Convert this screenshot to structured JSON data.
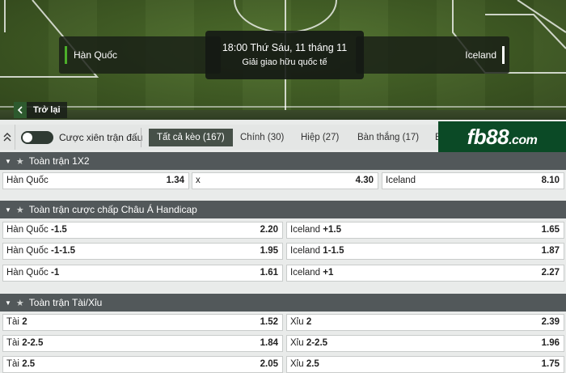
{
  "match": {
    "home_team": "Hàn Quốc",
    "away_team": "Iceland",
    "datetime": "18:00 Thứ Sáu, 11 tháng 11",
    "league": "Giải giao hữu quốc tế",
    "back_label": "Trở lại"
  },
  "toolbar": {
    "toggle_label": "Cược xiên trận đấu",
    "tabs": [
      {
        "label": "Tất cả kèo (167)",
        "active": true
      },
      {
        "label": "Chính (30)"
      },
      {
        "label": "Hiệp (27)"
      },
      {
        "label": "Bàn thắng (17)"
      },
      {
        "label": "B"
      }
    ]
  },
  "logo": {
    "text": "fb88",
    "suffix": ".com"
  },
  "sections": [
    {
      "title": "Toàn trận 1X2",
      "rows": [
        [
          {
            "label": "Hàn Quốc",
            "line": "",
            "odds": "1.34"
          },
          {
            "label": "x",
            "line": "",
            "odds": "4.30"
          },
          {
            "label": "Iceland",
            "line": "",
            "odds": "8.10"
          }
        ]
      ]
    },
    {
      "title": "Toàn trận cược chấp Châu Á Handicap",
      "rows": [
        [
          {
            "label": "Hàn Quốc",
            "line": "-1.5",
            "odds": "2.20"
          },
          {
            "label": "Iceland",
            "line": "+1.5",
            "odds": "1.65"
          }
        ],
        [
          {
            "label": "Hàn Quốc",
            "line": "-1-1.5",
            "odds": "1.95"
          },
          {
            "label": "Iceland",
            "line": "1-1.5",
            "odds": "1.87"
          }
        ],
        [
          {
            "label": "Hàn Quốc",
            "line": "-1",
            "odds": "1.61"
          },
          {
            "label": "Iceland",
            "line": "+1",
            "odds": "2.27"
          }
        ]
      ]
    },
    {
      "title": "Toàn trận Tài/Xỉu",
      "rows": [
        [
          {
            "label": "Tài",
            "line": "2",
            "odds": "1.52"
          },
          {
            "label": "Xỉu",
            "line": "2",
            "odds": "2.39"
          }
        ],
        [
          {
            "label": "Tài",
            "line": "2-2.5",
            "odds": "1.84"
          },
          {
            "label": "Xỉu",
            "line": "2-2.5",
            "odds": "1.96"
          }
        ],
        [
          {
            "label": "Tài",
            "line": "2.5",
            "odds": "2.05"
          },
          {
            "label": "Xỉu",
            "line": "2.5",
            "odds": "1.75"
          }
        ]
      ]
    }
  ]
}
